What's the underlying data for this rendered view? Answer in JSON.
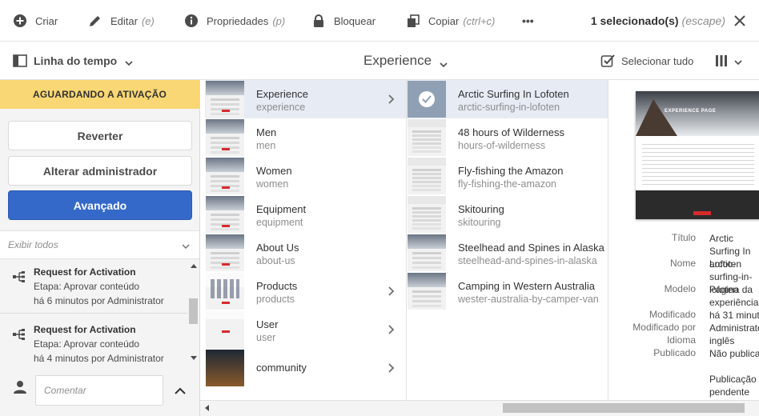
{
  "actionbar": {
    "create": "Criar",
    "edit": "Editar",
    "edit_key": "(e)",
    "properties": "Propriedades",
    "properties_key": "(p)",
    "lock": "Bloquear",
    "copy": "Copiar",
    "copy_key": "(ctrl+c)",
    "more": "•••",
    "selected_count": "1 selecionado(s)",
    "escape_key": "(escape)"
  },
  "subbar": {
    "rail_label": "Linha do tempo",
    "title": "Experience",
    "select_all": "Selecionar tudo"
  },
  "rail": {
    "status": "AGUARDANDO A ATIVAÇÃO",
    "revert": "Reverter",
    "change_admin": "Alterar administrador",
    "advance": "Avançado",
    "filter": "Exibir todos",
    "comment_placeholder": "Comentar",
    "timeline": [
      {
        "title": "Request for Activation",
        "step": "Etapa: Aprovar conteúdo",
        "time": "há 6 minutos por Administrator"
      },
      {
        "title": "Request for Activation",
        "step": "Etapa: Aprovar conteúdo",
        "time": "há 4 minutos por Administrator"
      }
    ]
  },
  "column1": [
    {
      "title": "Experience",
      "name": "experience",
      "arrow": true,
      "active": true
    },
    {
      "title": "Men",
      "name": "men"
    },
    {
      "title": "Women",
      "name": "women"
    },
    {
      "title": "Equipment",
      "name": "equipment"
    },
    {
      "title": "About Us",
      "name": "about-us"
    },
    {
      "title": "Products",
      "name": "products",
      "arrow": true
    },
    {
      "title": "User",
      "name": "user",
      "arrow": true
    },
    {
      "title": "community",
      "name": "",
      "arrow": true
    }
  ],
  "column2": [
    {
      "title": "Arctic Surfing In Lofoten",
      "name": "arctic-surfing-in-lofoten",
      "selected": true
    },
    {
      "title": "48 hours of Wilderness",
      "name": "hours-of-wilderness"
    },
    {
      "title": "Fly-fishing the Amazon",
      "name": "fly-fishing-the-amazon"
    },
    {
      "title": "Skitouring",
      "name": "skitouring"
    },
    {
      "title": "Steelhead and Spines in Alaska",
      "name": "steelhead-and-spines-in-alaska"
    },
    {
      "title": "Camping in Western Australia",
      "name": "wester-australia-by-camper-van"
    }
  ],
  "preview": {
    "caption": "EXPERIENCE PAGE",
    "meta": [
      {
        "label": "Título",
        "value": "Arctic Surfing In Lofoten"
      },
      {
        "label": "Nome",
        "value": "arctic-surfing-in-lofoten"
      },
      {
        "label": "Modelo",
        "value": "Página da experiência"
      },
      {
        "label": "Modificado",
        "value": "há 31 minutos"
      },
      {
        "label": "Modificado por",
        "value": "Administrator"
      },
      {
        "label": "Idioma",
        "value": "inglês"
      },
      {
        "label": "Publicado",
        "value": "Não publicado"
      },
      {
        "label": "",
        "value": "Publicação pendente"
      }
    ]
  },
  "colors": {
    "accent": "#3569c9",
    "status": "#f8d774",
    "active_row": "#e6ebf4"
  }
}
